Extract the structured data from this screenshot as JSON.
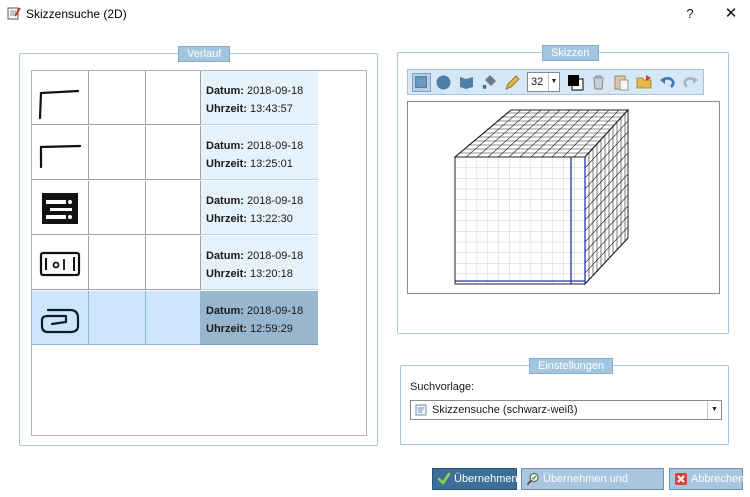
{
  "window": {
    "title": "Skizzensuche (2D)",
    "help_label": "?",
    "close_label": "✕"
  },
  "verlauf": {
    "caption": "Verlauf",
    "date_label": "Datum:",
    "time_label": "Uhrzeit:",
    "entries": [
      {
        "date": "2018-09-18",
        "time": "13:43:57",
        "thumbnail": "corner-line-sketch"
      },
      {
        "date": "2018-09-18",
        "time": "13:25:01",
        "thumbnail": "corner-line-sketch"
      },
      {
        "date": "2018-09-18",
        "time": "13:22:30",
        "thumbnail": "black-block-sketch"
      },
      {
        "date": "2018-09-18",
        "time": "13:20:18",
        "thumbnail": "rectangle-with-circles-sketch"
      },
      {
        "date": "2018-09-18",
        "time": "12:59:29",
        "thumbnail": "rounded-hook-sketch",
        "selected": true
      }
    ]
  },
  "skizzen": {
    "caption": "Skizzen",
    "toolbar": {
      "line_width": "32",
      "icons": [
        "fill-rect-icon",
        "circle-icon",
        "flag-icon",
        "paint-bucket-icon",
        "pencil-icon",
        "color-swatch-icon",
        "trash-icon",
        "paste-icon",
        "open-folder-icon",
        "undo-icon",
        "redo-icon"
      ]
    },
    "canvas": {
      "content": "grid-cube-sketch"
    }
  },
  "einstellungen": {
    "caption": "Einstellungen",
    "suchvorlage_label": "Suchvorlage:",
    "suchvorlage_value": "Skizzensuche (schwarz-weiß)"
  },
  "buttons": {
    "apply": "Übernehmen",
    "apply_search": "Übernehmen und Suchen",
    "cancel": "Abbrechen"
  },
  "colors": {
    "primary_button": "#3c6e96",
    "caption_bg": "#a3c6e0",
    "selected_row": "#cde6fb",
    "selected_info": "#98b6cd",
    "info_bg": "#e6f2fb",
    "cube_highlight": "#2436a8"
  }
}
